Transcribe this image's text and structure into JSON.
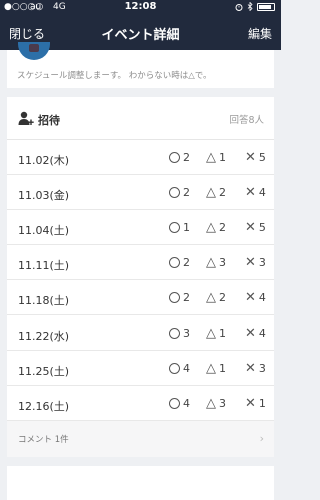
{
  "status_bar": {
    "signal": "●○○○○",
    "carrier": "au",
    "network": "4G",
    "time": "12:08"
  },
  "nav": {
    "close_label": "閉じる",
    "title": "イベント詳細",
    "edit_label": "編集"
  },
  "description": {
    "text": "スケジュール調整しまーす。 わからない時は△で。"
  },
  "invite": {
    "title": "招待",
    "answer_count": "回答8人",
    "rows": [
      {
        "date": "11.02(木)",
        "o": "2",
        "t": "1",
        "x": "5"
      },
      {
        "date": "11.03(金)",
        "o": "2",
        "t": "2",
        "x": "4"
      },
      {
        "date": "11.04(土)",
        "o": "1",
        "t": "2",
        "x": "5"
      },
      {
        "date": "11.11(土)",
        "o": "2",
        "t": "3",
        "x": "3"
      },
      {
        "date": "11.18(土)",
        "o": "2",
        "t": "2",
        "x": "4"
      },
      {
        "date": "11.22(水)",
        "o": "3",
        "t": "1",
        "x": "4"
      },
      {
        "date": "11.25(土)",
        "o": "4",
        "t": "1",
        "x": "3"
      },
      {
        "date": "12.16(土)",
        "o": "4",
        "t": "3",
        "x": "1"
      }
    ],
    "comment_label": "コメント 1件"
  },
  "symbols": {
    "triangle": "△",
    "cross": "✕",
    "chevron": "›"
  }
}
